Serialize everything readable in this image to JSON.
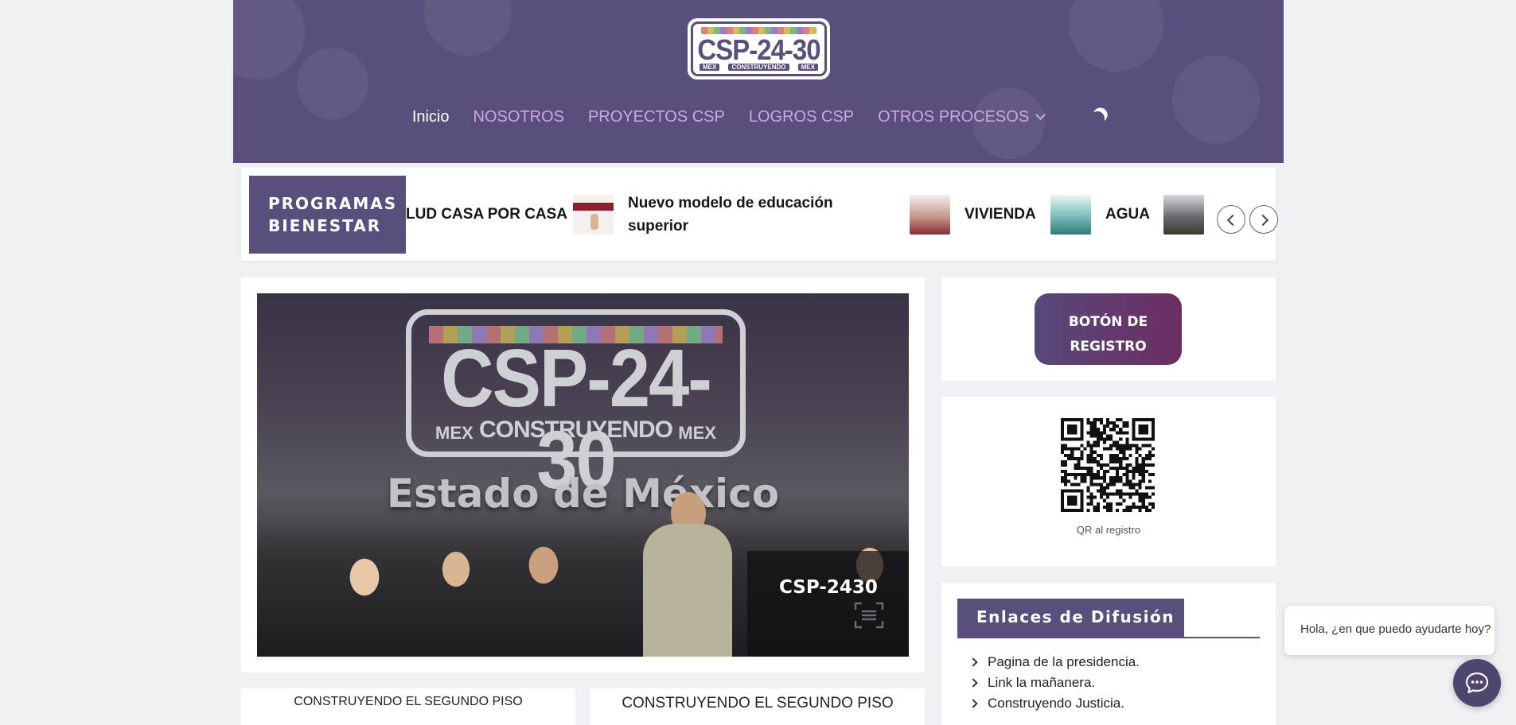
{
  "header": {
    "logo": {
      "title": "CSP-24-30",
      "subtitle": "CONSTRUYENDO",
      "left_tag": "MEX",
      "right_tag": "MEX"
    },
    "nav": [
      {
        "label": "Inicio",
        "active": true
      },
      {
        "label": "NOSOTROS"
      },
      {
        "label": "PROYECTOS CSP"
      },
      {
        "label": "LOGROS CSP"
      },
      {
        "label": "OTROS PROCESOS",
        "has_dropdown": true
      }
    ],
    "theme_toggle_icon": "moon-icon"
  },
  "ticker": {
    "label_line1": "PROGRAMAS",
    "label_line2": "BIENESTAR",
    "items": [
      {
        "title": "LUD CASA POR CASA"
      },
      {
        "title_line1": "Nuevo modelo de educación",
        "title_line2": "superior"
      },
      {
        "title": "VIVIENDA"
      },
      {
        "title": "AGUA"
      }
    ]
  },
  "hero": {
    "image_text": {
      "big": "CSP-24-30",
      "left_tag": "MEX",
      "middle": "CONSTRUYENDO",
      "right_tag": "MEX",
      "state": "Estado de México"
    },
    "caption": "CSP-2430"
  },
  "sidebar": {
    "register_button_line1": "BOTÓN DE",
    "register_button_line2": "REGISTRO",
    "qr_caption": "QR al registro",
    "links_title": "Enlaces de Difusión",
    "links": [
      "Pagina de la presidencia.",
      "Link la mañanera.",
      "Construyendo Justicia."
    ]
  },
  "bottom_cards": [
    {
      "label": "CONSTRUYENDO EL SEGUNDO PISO"
    },
    {
      "label": "CONSTRUYENDO EL SEGUNDO PISO"
    }
  ],
  "chat": {
    "greeting": "Hola, ¿en que puedo ayudarte hoy?"
  },
  "colors": {
    "brand_purple": "#5a4f7c",
    "nav_text": "#c9a6e6",
    "button_gradient_end": "#6e2d62",
    "page_background": "#eef0f4"
  }
}
